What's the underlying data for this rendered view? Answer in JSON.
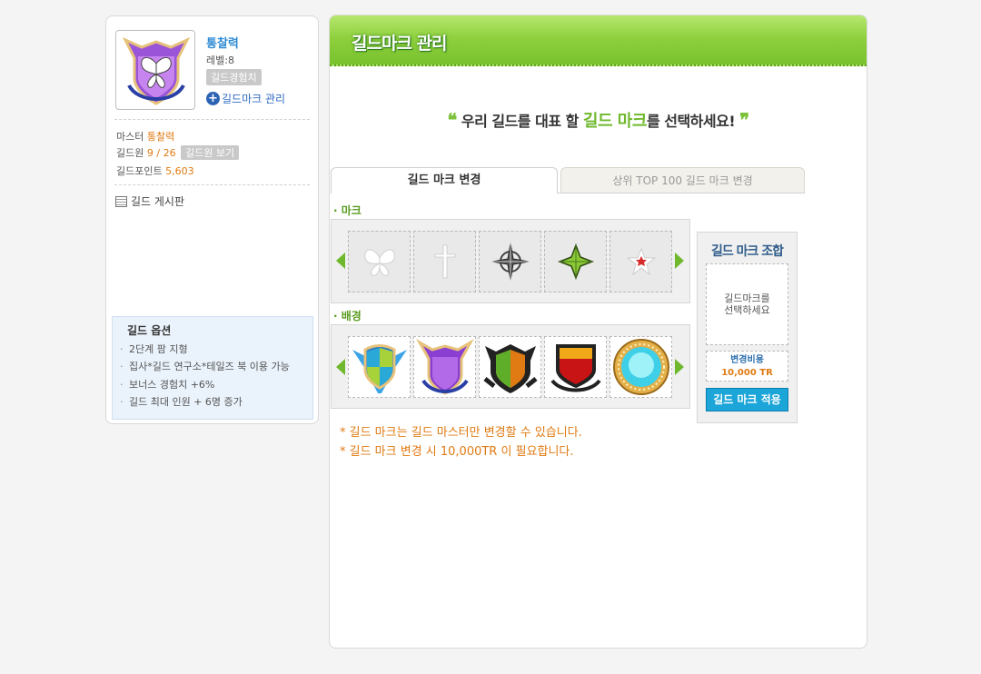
{
  "guild": {
    "name": "통찰력",
    "level": "레벨:8",
    "exp_button": "길드경험치",
    "manage_link": "길드마크 관리",
    "master_label": "마스터",
    "master_name": "통찰력",
    "members_label": "길드원",
    "members_value": "9 / 26",
    "members_button": "길드원 보기",
    "points_label": "길드포인트",
    "points_value": "5,603",
    "board_link": "길드 게시판"
  },
  "options": {
    "title": "길드 옵션",
    "items": [
      "2단계 팜 지형",
      "집사*길드 연구소*테일즈 북 이용 가능",
      "보너스 경험치 +6%",
      "길드 최대 인원 + 6명 증가"
    ]
  },
  "main": {
    "header_title": "길드마크 관리",
    "slogan_open": "❝",
    "slogan_pre": "우리 길드를 대표 할",
    "slogan_highlight": "길드 마크",
    "slogan_post": "를 선택하세요!",
    "slogan_close": "❞",
    "tabs": [
      {
        "label": "길드 마크 변경",
        "active": true
      },
      {
        "label": "상위 TOP 100 길드 마크 변경",
        "active": false
      }
    ],
    "mark_section_label": "· 마크",
    "background_section_label": "· 배경",
    "marks": [
      "butterfly-icon",
      "cross-icon",
      "compass-star-icon",
      "green-star-icon",
      "red-star-icon"
    ],
    "backgrounds": [
      "blue-shield-icon",
      "purple-shield-icon",
      "green-shield-icon",
      "red-shield-icon",
      "circle-emblem-icon"
    ],
    "combo": {
      "title": "길드 마크 조합",
      "preview_text": "길드마크를\n선택하세요",
      "cost_label": "변경비용",
      "cost_value": "10,000 TR",
      "apply_button": "길드 마크 적용"
    },
    "notes": [
      "* 길드 마크는 길드 마스터만 변경할 수 있습니다.",
      "* 길드 마크 변경 시 10,000TR 이 필요합니다."
    ]
  },
  "colors": {
    "accent_green": "#78c22d",
    "link_blue": "#2e8bd5",
    "orange": "#e07a12",
    "apply_blue": "#1ba5d8"
  }
}
